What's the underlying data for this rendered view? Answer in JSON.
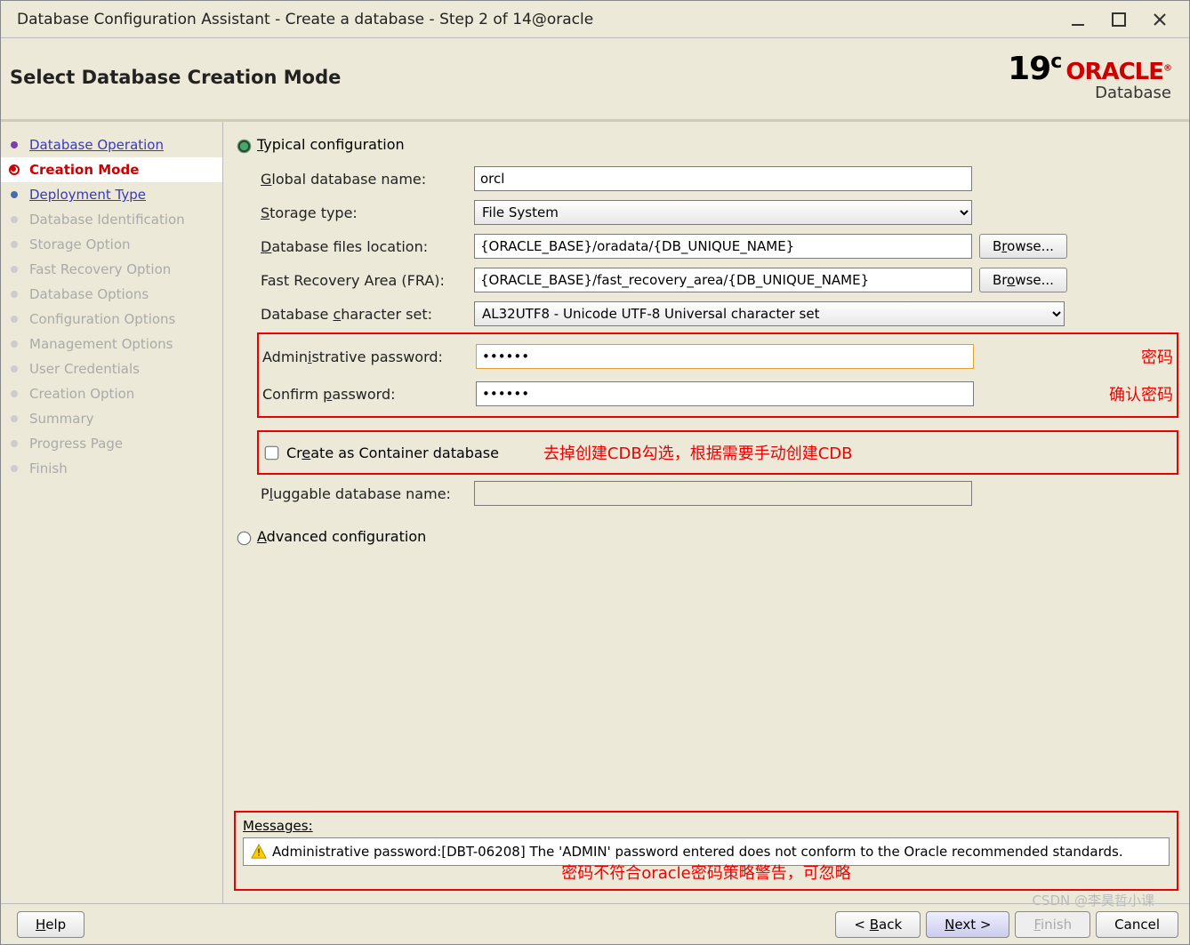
{
  "window": {
    "title": "Database Configuration Assistant - Create a database - Step 2 of 14@oracle"
  },
  "header": {
    "heading": "Select Database Creation Mode",
    "version": "19",
    "versup": "c",
    "brand": "ORACLE",
    "product": "Database"
  },
  "sidebar": {
    "items": [
      {
        "label": "Database Operation",
        "state": "completed"
      },
      {
        "label": "Creation Mode",
        "state": "current"
      },
      {
        "label": "Deployment Type",
        "state": "next"
      },
      {
        "label": "Database Identification",
        "state": "disabled"
      },
      {
        "label": "Storage Option",
        "state": "disabled"
      },
      {
        "label": "Fast Recovery Option",
        "state": "disabled"
      },
      {
        "label": "Database Options",
        "state": "disabled"
      },
      {
        "label": "Configuration Options",
        "state": "disabled"
      },
      {
        "label": "Management Options",
        "state": "disabled"
      },
      {
        "label": "User Credentials",
        "state": "disabled"
      },
      {
        "label": "Creation Option",
        "state": "disabled"
      },
      {
        "label": "Summary",
        "state": "disabled"
      },
      {
        "label": "Progress Page",
        "state": "disabled"
      },
      {
        "label": "Finish",
        "state": "disabled"
      }
    ]
  },
  "form": {
    "typical_label": "Typical configuration",
    "advanced_label": "Advanced configuration",
    "global_db_label": "Global database name:",
    "global_db_value": "orcl",
    "storage_label": "Storage type:",
    "storage_value": "File System",
    "files_label": "Database files location:",
    "files_value": "{ORACLE_BASE}/oradata/{DB_UNIQUE_NAME}",
    "fra_label": "Fast Recovery Area (FRA):",
    "fra_value": "{ORACLE_BASE}/fast_recovery_area/{DB_UNIQUE_NAME}",
    "charset_label": "Database character set:",
    "charset_value": "AL32UTF8 - Unicode UTF-8 Universal character set",
    "admin_pw_label": "Administrative password:",
    "admin_pw_value": "••••••",
    "confirm_pw_label": "Confirm password:",
    "confirm_pw_value": "••••••",
    "cdb_label": "Create as Container database",
    "pdb_label": "Pluggable database name:",
    "browse": "Browse..."
  },
  "annotations": {
    "pw": "密码",
    "confirm_pw": "确认密码",
    "cdb": "去掉创建CDB勾选，根据需要手动创建CDB",
    "msg": "密码不符合oracle密码策略警告，可忽略"
  },
  "messages": {
    "label": "Messages:",
    "text": "Administrative password:[DBT-06208] The 'ADMIN' password entered does not conform to the Oracle recommended standards."
  },
  "footer": {
    "help": "Help",
    "back": "< Back",
    "next": "Next >",
    "finish": "Finish",
    "cancel": "Cancel"
  },
  "watermark": "CSDN @李昊哲小课"
}
